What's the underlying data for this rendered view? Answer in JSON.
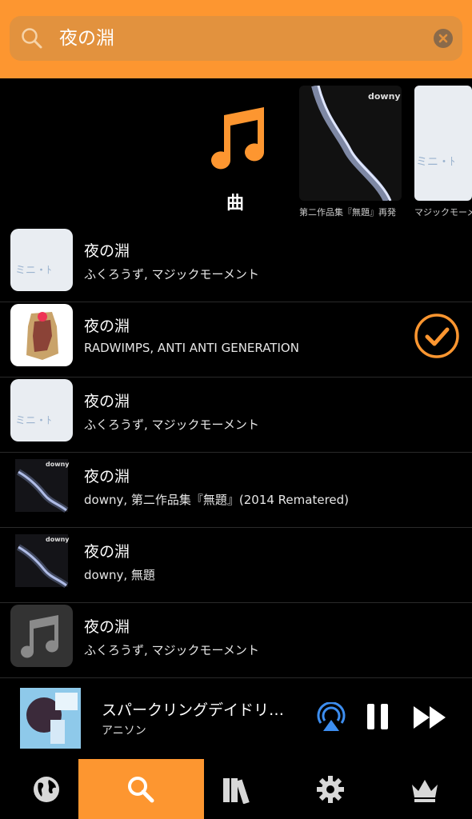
{
  "search": {
    "query": "夜の淵"
  },
  "category": {
    "label": "曲"
  },
  "albums": [
    {
      "caption": "第二作品集『無題』再発"
    },
    {
      "caption": "マジックモーメント"
    }
  ],
  "songs": [
    {
      "title": "夜の淵",
      "subtitle": "ふくろうず, マジックモーメント",
      "art": "white",
      "selected": false
    },
    {
      "title": "夜の淵",
      "subtitle": "RADWIMPS, ANTI ANTI GENERATION",
      "art": "rad",
      "selected": true
    },
    {
      "title": "夜の淵",
      "subtitle": "ふくろうず, マジックモーメント",
      "art": "white",
      "selected": false
    },
    {
      "title": "夜の淵",
      "subtitle": "downy, 第二作品集『無題』(2014 Rematered)",
      "art": "downy",
      "selected": false
    },
    {
      "title": "夜の淵",
      "subtitle": "downy, 無題",
      "art": "downy",
      "selected": false
    },
    {
      "title": "夜の淵",
      "subtitle": "ふくろうず, マジックモーメント",
      "art": "note",
      "selected": false
    }
  ],
  "now_playing": {
    "title": "スパークリングデイドリ…",
    "subtitle": "アニソン"
  },
  "tabs": [
    {
      "icon": "globe-icon",
      "active": false
    },
    {
      "icon": "search-icon",
      "active": true
    },
    {
      "icon": "library-icon",
      "active": false
    },
    {
      "icon": "gear-icon",
      "active": false
    },
    {
      "icon": "crown-icon",
      "active": false
    }
  ],
  "colors": {
    "accent": "#fd9630",
    "search_bg": "#e2923e",
    "background": "#000000"
  }
}
